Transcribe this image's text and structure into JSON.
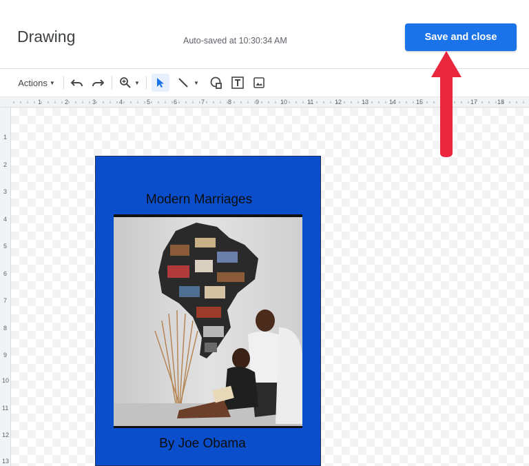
{
  "header": {
    "title": "Drawing",
    "autosave": "Auto-saved at 10:30:34 AM",
    "save_label": "Save and close"
  },
  "toolbar": {
    "actions_label": "Actions",
    "icons": [
      "undo-icon",
      "redo-icon",
      "zoom-icon",
      "select-icon",
      "line-icon",
      "shape-icon",
      "text-box-icon",
      "image-icon"
    ]
  },
  "ruler": {
    "top": [
      "1",
      "2",
      "3",
      "4",
      "5",
      "6",
      "7",
      "8",
      "9",
      "10",
      "11",
      "12",
      "13",
      "14",
      "15",
      "17",
      "18"
    ],
    "left": [
      "1",
      "2",
      "3",
      "4",
      "5",
      "6",
      "7",
      "8",
      "9",
      "10",
      "11",
      "12",
      "13"
    ]
  },
  "cover": {
    "title": "Modern Marriages",
    "author": "By Joe Obama"
  },
  "colors": {
    "accent": "#1a73e8",
    "cover": "#0a4ecb",
    "arrow": "#e8263d"
  }
}
